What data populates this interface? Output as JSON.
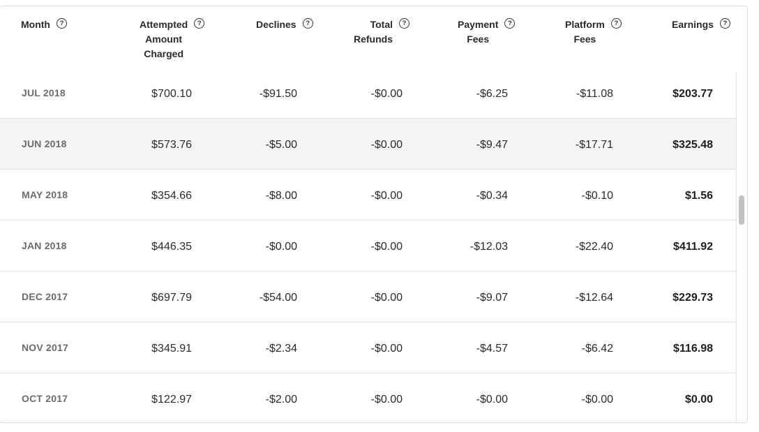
{
  "table": {
    "columns": [
      {
        "key": "month",
        "label": "Month"
      },
      {
        "key": "attempted",
        "label": "Attempted\nAmount\nCharged"
      },
      {
        "key": "declines",
        "label": "Declines"
      },
      {
        "key": "refunds",
        "label": "Total\nRefunds"
      },
      {
        "key": "payment_fees",
        "label": "Payment\nFees"
      },
      {
        "key": "platform_fees",
        "label": "Platform\nFees"
      },
      {
        "key": "earnings",
        "label": "Earnings"
      }
    ],
    "rows": [
      {
        "month": "JUL 2018",
        "attempted": "$700.10",
        "declines": "-$91.50",
        "refunds": "-$0.00",
        "payment_fees": "-$6.25",
        "platform_fees": "-$11.08",
        "earnings": "$203.77"
      },
      {
        "month": "JUN 2018",
        "attempted": "$573.76",
        "declines": "-$5.00",
        "refunds": "-$0.00",
        "payment_fees": "-$9.47",
        "platform_fees": "-$17.71",
        "earnings": "$325.48"
      },
      {
        "month": "MAY 2018",
        "attempted": "$354.66",
        "declines": "-$8.00",
        "refunds": "-$0.00",
        "payment_fees": "-$0.34",
        "platform_fees": "-$0.10",
        "earnings": "$1.56"
      },
      {
        "month": "JAN 2018",
        "attempted": "$446.35",
        "declines": "-$0.00",
        "refunds": "-$0.00",
        "payment_fees": "-$12.03",
        "platform_fees": "-$22.40",
        "earnings": "$411.92"
      },
      {
        "month": "DEC 2017",
        "attempted": "$697.79",
        "declines": "-$54.00",
        "refunds": "-$0.00",
        "payment_fees": "-$9.07",
        "platform_fees": "-$12.64",
        "earnings": "$229.73"
      },
      {
        "month": "NOV 2017",
        "attempted": "$345.91",
        "declines": "-$2.34",
        "refunds": "-$0.00",
        "payment_fees": "-$4.57",
        "platform_fees": "-$6.42",
        "earnings": "$116.98"
      },
      {
        "month": "OCT 2017",
        "attempted": "$122.97",
        "declines": "-$2.00",
        "refunds": "-$0.00",
        "payment_fees": "-$0.00",
        "platform_fees": "-$0.00",
        "earnings": "$0.00"
      }
    ]
  },
  "colors": {
    "highlight_row": "#f4f4f2",
    "border": "#e2e2e2",
    "month_text": "#6b6b6b"
  }
}
